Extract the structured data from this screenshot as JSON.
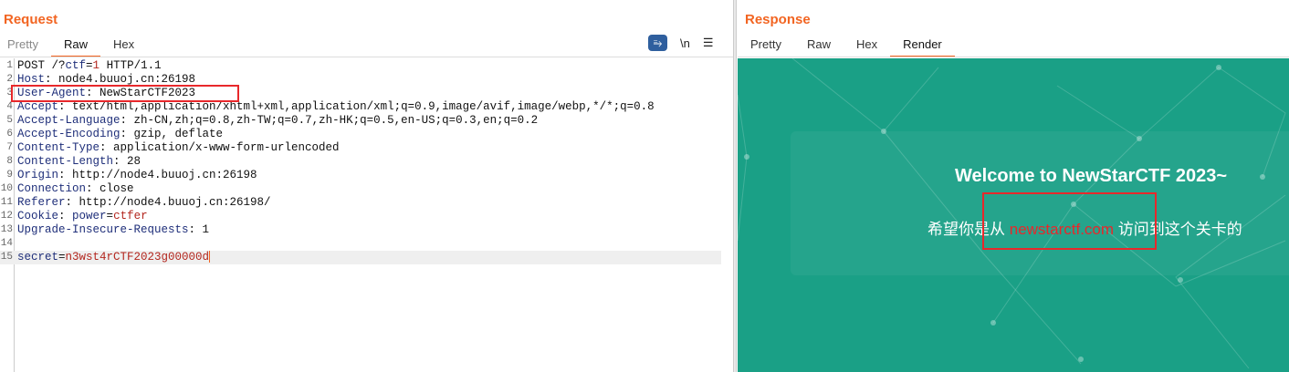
{
  "request": {
    "title": "Request",
    "tabs": [
      "Pretty",
      "Raw",
      "Hex"
    ],
    "active_tab": "Raw",
    "tools": {
      "wrap_icon": "word-wrap-icon",
      "newline": "\\n",
      "menu_icon": "hamburger-menu-icon"
    },
    "lines": [
      [
        [
          "v",
          "POST /?"
        ],
        [
          "k",
          "ctf"
        ],
        [
          "v",
          "="
        ],
        [
          "r",
          "1"
        ],
        [
          "v",
          " HTTP/1.1"
        ]
      ],
      [
        [
          "k",
          "Host"
        ],
        [
          "v",
          ": node4.buuoj.cn:26198"
        ]
      ],
      [
        [
          "k",
          "User-Agent"
        ],
        [
          "v",
          ": NewStarCTF2023"
        ]
      ],
      [
        [
          "k",
          "Accept"
        ],
        [
          "v",
          ": text/html,application/xhtml+xml,application/xml;q=0.9,image/avif,image/webp,*/*;q=0.8"
        ]
      ],
      [
        [
          "k",
          "Accept-Language"
        ],
        [
          "v",
          ": zh-CN,zh;q=0.8,zh-TW;q=0.7,zh-HK;q=0.5,en-US;q=0.3,en;q=0.2"
        ]
      ],
      [
        [
          "k",
          "Accept-Encoding"
        ],
        [
          "v",
          ": gzip, deflate"
        ]
      ],
      [
        [
          "k",
          "Content-Type"
        ],
        [
          "v",
          ": application/x-www-form-urlencoded"
        ]
      ],
      [
        [
          "k",
          "Content-Length"
        ],
        [
          "v",
          ": 28"
        ]
      ],
      [
        [
          "k",
          "Origin"
        ],
        [
          "v",
          ": http://node4.buuoj.cn:26198"
        ]
      ],
      [
        [
          "k",
          "Connection"
        ],
        [
          "v",
          ": close"
        ]
      ],
      [
        [
          "k",
          "Referer"
        ],
        [
          "v",
          ": http://node4.buuoj.cn:26198/"
        ]
      ],
      [
        [
          "k",
          "Cookie"
        ],
        [
          "v",
          ": "
        ],
        [
          "k",
          "power"
        ],
        [
          "v",
          "="
        ],
        [
          "r",
          "ctfer"
        ]
      ],
      [
        [
          "k",
          "Upgrade-Insecure-Requests"
        ],
        [
          "v",
          ": 1"
        ]
      ],
      [],
      [
        [
          "k",
          "secret"
        ],
        [
          "v",
          "="
        ],
        [
          "r",
          "n3wst4rCTF2023g00000d"
        ]
      ]
    ]
  },
  "response": {
    "title": "Response",
    "tabs": [
      "Pretty",
      "Raw",
      "Hex",
      "Render"
    ],
    "active_tab": "Render",
    "render": {
      "heading": "Welcome to NewStarCTF 2023~",
      "msg_before": "希望你是从 ",
      "msg_link": "newstarctf.com",
      "msg_after": " 访问到这个关卡的",
      "bg_color": "#1aa086"
    }
  },
  "colors": {
    "accent": "#f26522",
    "highlight_box": "#e8282b"
  }
}
